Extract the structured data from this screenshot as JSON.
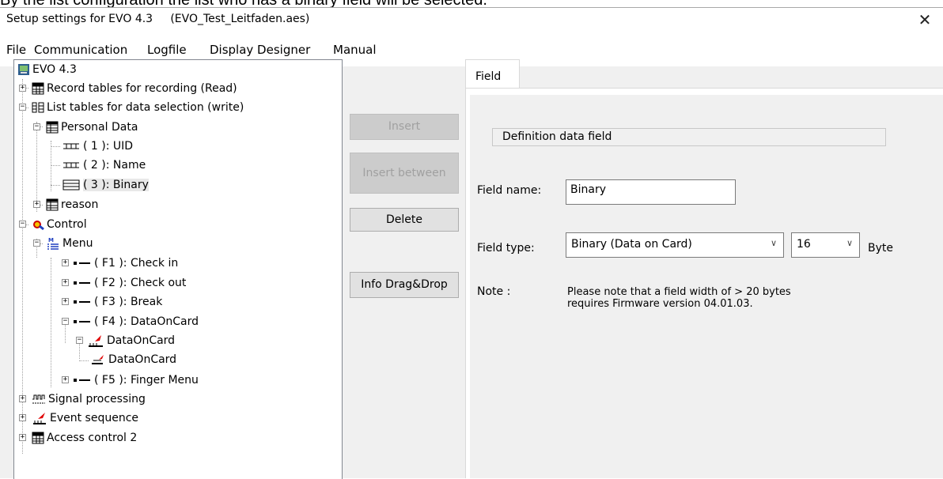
{
  "caption": "By the list configuration the list who has a binary field will be selected.",
  "window": {
    "title": "Setup settings for EVO 4.3     (EVO_Test_Leitfaden.aes)",
    "close_glyph": "✕"
  },
  "menu": [
    "File",
    "Communication",
    "Logfile",
    "Display Designer",
    "Manual"
  ],
  "tree": {
    "root": "EVO 4.3",
    "record_tables": "Record tables for recording (Read)",
    "list_tables": "List tables for data selection (write)",
    "personal_data": "Personal Data",
    "field_1": "( 1 ): UID",
    "field_2": "( 2 ): Name",
    "field_3": "( 3 ): Binary",
    "reason": "reason",
    "control": "Control",
    "menu": "Menu",
    "f1": "( F1 ): Check in",
    "f2": "( F2 ): Check out",
    "f3": "( F3 ): Break",
    "f4": "( F4 ): DataOnCard",
    "f4_child": "DataOnCard",
    "f4_grandchild": "DataOnCard",
    "f5": "( F5 ): Finger Menu",
    "signal": "Signal processing",
    "event": "Event sequence",
    "access": "Access control 2",
    "expanded_symbol": "−",
    "collapsed_symbol": "+"
  },
  "buttons": {
    "insert": "Insert",
    "insert_between": "Insert between",
    "delete": "Delete",
    "info": "Info Drag&Drop"
  },
  "tab": {
    "label": "Field",
    "group_title": "Definition data field",
    "field_name_label": "Field name:",
    "field_name_value": "Binary",
    "field_type_label": "Field type:",
    "field_type_value": "Binary (Data on Card)",
    "size_value": "16",
    "size_unit": "Byte",
    "note_label": "Note :",
    "note_line1": "Please note that a field width of > 20 bytes",
    "note_line2": "requires Firmware version 04.01.03.",
    "dropdown_arrow": "∨"
  },
  "colors": {
    "window_bg": "#f0f0f0",
    "panel_bg": "#ffffff",
    "disabled_text": "#a0a0a0",
    "selection_bg": "#e8e8e8"
  }
}
